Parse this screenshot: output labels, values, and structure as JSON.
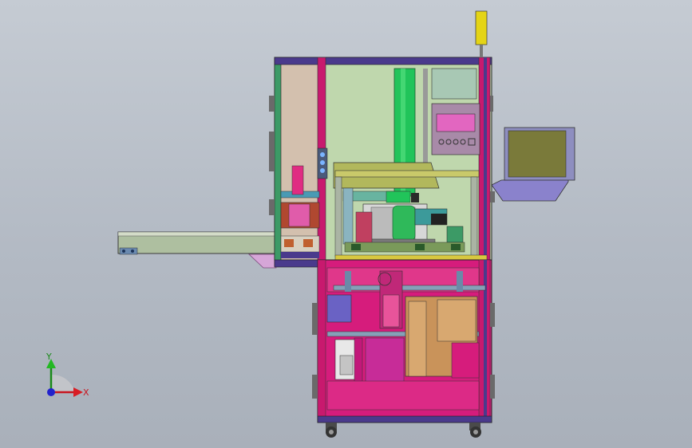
{
  "viewport": {
    "background_top": "#c5cbd3",
    "background_bottom": "#a9b0ba",
    "model_description_colors": {
      "frame": "#4a3a8c",
      "frame_accent": "#c8196e",
      "panel_green": "#bcd6a8",
      "green_cylinder": "#21c45a",
      "magenta_housing": "#d8127a",
      "wood_plate": "#c9935a",
      "conveyor": "#b8c8a8",
      "hmi_screen": "#7a7a3a",
      "beacon": "#e4d416"
    }
  },
  "triad": {
    "x_label": "X",
    "y_label": "Y",
    "x_color": "#c8141e",
    "y_color": "#1a8a1a",
    "z_color": "#2222cc"
  }
}
